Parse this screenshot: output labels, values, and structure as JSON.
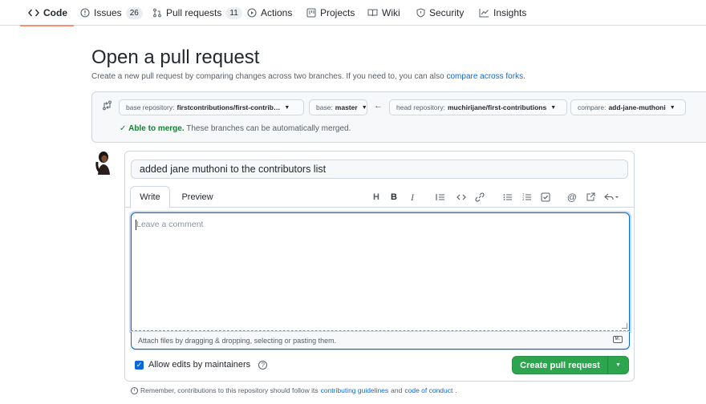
{
  "nav": {
    "code": "Code",
    "issues": "Issues",
    "issues_count": "26",
    "pull_requests": "Pull requests",
    "pull_requests_count": "11",
    "actions": "Actions",
    "projects": "Projects",
    "wiki": "Wiki",
    "security": "Security",
    "insights": "Insights"
  },
  "header": {
    "title": "Open a pull request",
    "subtitle_prefix": "Create a new pull request by comparing changes across two branches. If you need to, you can also ",
    "subtitle_link": "compare across forks",
    "subtitle_suffix": "."
  },
  "compare": {
    "base_repo_key": "base repository:",
    "base_repo_value": "firstcontributions/first-contrib…",
    "base_key": "base:",
    "base_value": "master",
    "head_repo_key": "head repository:",
    "head_repo_value": "muchirijane/first-contributions",
    "compare_key": "compare:",
    "compare_value": "add-jane-muthoni",
    "able": "Able to merge.",
    "able_desc": "These branches can be automatically merged."
  },
  "form": {
    "title_value": "added jane muthoni to the contributors list",
    "tab_write": "Write",
    "tab_preview": "Preview",
    "comment_placeholder": "Leave a comment",
    "attach_text": "Attach files by dragging & dropping, selecting or pasting them.",
    "md_badge": "M↓",
    "allow_edits": "Allow edits by maintainers",
    "create_button": "Create pull request"
  },
  "footer": {
    "prefix": "Remember, contributions to this repository should follow its ",
    "link1": "contributing guidelines",
    "middle": " and ",
    "link2": "code of conduct",
    "suffix": "."
  },
  "colors": {
    "accent": "#0969da",
    "success": "#2da44e",
    "tab_underline": "#fd8c73"
  }
}
